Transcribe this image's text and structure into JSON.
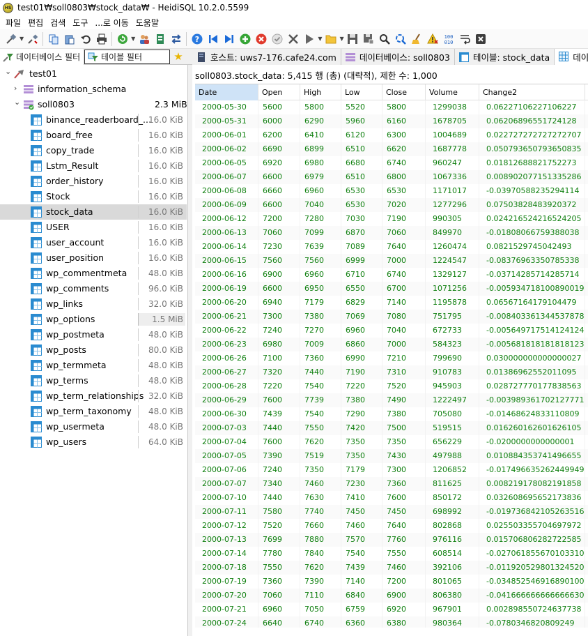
{
  "window": {
    "title": "test01₩soll0803₩stock_data₩ - HeidiSQL 10.2.0.5599",
    "logo_text": "HS"
  },
  "menu": [
    "파일",
    "편집",
    "검색",
    "도구",
    "...로 이동",
    "도움말"
  ],
  "toolbar_icons": [
    "connect-icon",
    "disconnect-icon",
    "copy-icon",
    "paste-icon",
    "undo-icon",
    "print-icon",
    "refresh-icon",
    "user-manager-icon",
    "export-icon",
    "transfer-icon",
    "help-icon",
    "first-icon",
    "last-icon",
    "add-icon",
    "delete-icon",
    "check-icon",
    "cancel-icon",
    "run-icon",
    "open-folder-icon",
    "save-icon",
    "save-as-icon",
    "find-icon",
    "find-replace-icon",
    "clean-icon",
    "warning-icon",
    "binary-icon",
    "wordwrap-icon",
    "clear-icon"
  ],
  "filters": {
    "db_filter": "데이터베이스 필터",
    "table_filter": "테이블 필터"
  },
  "tabs": [
    {
      "label": "호스트: uws7-176.cafe24.com",
      "icon": "host-icon"
    },
    {
      "label": "데이터베이스: soll0803",
      "icon": "database-icon"
    },
    {
      "label": "테이블: stock_data",
      "icon": "table-icon"
    },
    {
      "label": "데이터",
      "icon": "grid-icon",
      "active": true
    }
  ],
  "tree": {
    "root": "test01",
    "databases": [
      {
        "name": "information_schema"
      },
      {
        "name": "soll0803",
        "size": "2.3 MiB"
      }
    ],
    "tables": [
      {
        "name": "binance_readerboard_...",
        "size": "16.0 KiB"
      },
      {
        "name": "board_free",
        "size": "16.0 KiB"
      },
      {
        "name": "copy_trade",
        "size": "16.0 KiB"
      },
      {
        "name": "Lstm_Result",
        "size": "16.0 KiB"
      },
      {
        "name": "order_history",
        "size": "16.0 KiB"
      },
      {
        "name": "Stock",
        "size": "16.0 KiB"
      },
      {
        "name": "stock_data",
        "size": "16.0 KiB",
        "selected": true
      },
      {
        "name": "USER",
        "size": "16.0 KiB"
      },
      {
        "name": "user_account",
        "size": "16.0 KiB"
      },
      {
        "name": "user_position",
        "size": "16.0 KiB"
      },
      {
        "name": "wp_commentmeta",
        "size": "48.0 KiB"
      },
      {
        "name": "wp_comments",
        "size": "96.0 KiB"
      },
      {
        "name": "wp_links",
        "size": "32.0 KiB"
      },
      {
        "name": "wp_options",
        "size": "1.5 MiB",
        "highlight": true
      },
      {
        "name": "wp_postmeta",
        "size": "48.0 KiB"
      },
      {
        "name": "wp_posts",
        "size": "80.0 KiB"
      },
      {
        "name": "wp_termmeta",
        "size": "48.0 KiB"
      },
      {
        "name": "wp_terms",
        "size": "48.0 KiB"
      },
      {
        "name": "wp_term_relationships",
        "size": "32.0 KiB"
      },
      {
        "name": "wp_term_taxonomy",
        "size": "48.0 KiB"
      },
      {
        "name": "wp_usermeta",
        "size": "48.0 KiB"
      },
      {
        "name": "wp_users",
        "size": "64.0 KiB"
      }
    ]
  },
  "data_view": {
    "info": "soll0803.stock_data: 5,415 행 (총) (대략적), 제한 수: 1,000",
    "columns": [
      "Date",
      "Open",
      "High",
      "Low",
      "Close",
      "Volume",
      "Change2"
    ],
    "rows": [
      [
        "2000-05-30",
        "5600",
        "5800",
        "5520",
        "5800",
        "1299038",
        "0.06227106227106227"
      ],
      [
        "2000-05-31",
        "6000",
        "6290",
        "5960",
        "6160",
        "1678705",
        "0.06206896551724128"
      ],
      [
        "2000-06-01",
        "6200",
        "6410",
        "6120",
        "6300",
        "1004689",
        "0.022727272727272707"
      ],
      [
        "2000-06-02",
        "6690",
        "6899",
        "6510",
        "6620",
        "1687778",
        "0.050793650793650835"
      ],
      [
        "2000-06-05",
        "6920",
        "6980",
        "6680",
        "6740",
        "960247",
        "0.01812688821752273"
      ],
      [
        "2000-06-07",
        "6600",
        "6979",
        "6510",
        "6800",
        "1067336",
        "0.008902077151335286"
      ],
      [
        "2000-06-08",
        "6660",
        "6960",
        "6530",
        "6530",
        "1171017",
        "-0.03970588235294114"
      ],
      [
        "2000-06-09",
        "6600",
        "7040",
        "6530",
        "7020",
        "1277296",
        "0.07503828483920372"
      ],
      [
        "2000-06-12",
        "7200",
        "7280",
        "7030",
        "7190",
        "990305",
        "0.024216524216524205"
      ],
      [
        "2000-06-13",
        "7060",
        "7099",
        "6870",
        "7060",
        "849970",
        "-0.01808066759388038"
      ],
      [
        "2000-06-14",
        "7230",
        "7639",
        "7089",
        "7640",
        "1260474",
        "0.0821529745042493"
      ],
      [
        "2000-06-15",
        "7560",
        "7560",
        "6999",
        "7000",
        "1224547",
        "-0.08376963350785338"
      ],
      [
        "2000-06-16",
        "6900",
        "6960",
        "6710",
        "6740",
        "1329127",
        "-0.03714285714285714"
      ],
      [
        "2000-06-19",
        "6600",
        "6950",
        "6550",
        "6700",
        "1071256",
        "-0.005934718100890019"
      ],
      [
        "2000-06-20",
        "6940",
        "7179",
        "6829",
        "7140",
        "1195878",
        "0.06567164179104479"
      ],
      [
        "2000-06-21",
        "7300",
        "7380",
        "7069",
        "7080",
        "751795",
        "-0.008403361344537878"
      ],
      [
        "2000-06-22",
        "7240",
        "7270",
        "6960",
        "7040",
        "672733",
        "-0.005649717514124124"
      ],
      [
        "2000-06-23",
        "6980",
        "7009",
        "6860",
        "7000",
        "584323",
        "-0.005681818181818123"
      ],
      [
        "2000-06-26",
        "7100",
        "7360",
        "6990",
        "7210",
        "799690",
        "0.030000000000000027"
      ],
      [
        "2000-06-27",
        "7320",
        "7440",
        "7190",
        "7310",
        "910783",
        "0.01386962552011095"
      ],
      [
        "2000-06-28",
        "7220",
        "7540",
        "7220",
        "7520",
        "945903",
        "0.028727770177838563"
      ],
      [
        "2000-06-29",
        "7600",
        "7739",
        "7380",
        "7490",
        "1222497",
        "-0.003989361702127771"
      ],
      [
        "2000-06-30",
        "7439",
        "7540",
        "7290",
        "7380",
        "705080",
        "-0.01468624833110809"
      ],
      [
        "2000-07-03",
        "7440",
        "7550",
        "7420",
        "7500",
        "519515",
        "0.016260162601626105"
      ],
      [
        "2000-07-04",
        "7600",
        "7620",
        "7350",
        "7350",
        "656229",
        "-0.0200000000000001"
      ],
      [
        "2000-07-05",
        "7390",
        "7519",
        "7350",
        "7430",
        "497988",
        "0.010884353741496655"
      ],
      [
        "2000-07-06",
        "7240",
        "7350",
        "7179",
        "7300",
        "1206852",
        "-0.017496635262449949"
      ],
      [
        "2000-07-07",
        "7340",
        "7460",
        "7230",
        "7360",
        "811625",
        "0.008219178082191858"
      ],
      [
        "2000-07-10",
        "7440",
        "7630",
        "7410",
        "7600",
        "850172",
        "0.032608695652173836"
      ],
      [
        "2000-07-11",
        "7580",
        "7740",
        "7450",
        "7450",
        "698992",
        "-0.019736842105263516"
      ],
      [
        "2000-07-12",
        "7520",
        "7660",
        "7460",
        "7640",
        "802868",
        "0.025503355704697972"
      ],
      [
        "2000-07-13",
        "7699",
        "7880",
        "7570",
        "7760",
        "976116",
        "0.015706806282722585"
      ],
      [
        "2000-07-14",
        "7780",
        "7840",
        "7540",
        "7550",
        "608514",
        "-0.027061855670103310"
      ],
      [
        "2000-07-18",
        "7550",
        "7620",
        "7439",
        "7460",
        "392106",
        "-0.011920529801324520"
      ],
      [
        "2000-07-19",
        "7360",
        "7390",
        "7140",
        "7200",
        "801065",
        "-0.034852546916890100"
      ],
      [
        "2000-07-20",
        "7060",
        "7110",
        "6840",
        "6900",
        "806380",
        "-0.041666666666666630"
      ],
      [
        "2000-07-21",
        "6960",
        "7050",
        "6759",
        "6920",
        "967901",
        "0.002898550724637738"
      ],
      [
        "2000-07-24",
        "6640",
        "6740",
        "6360",
        "6380",
        "980364",
        "-0.0780346820809249"
      ]
    ]
  }
}
